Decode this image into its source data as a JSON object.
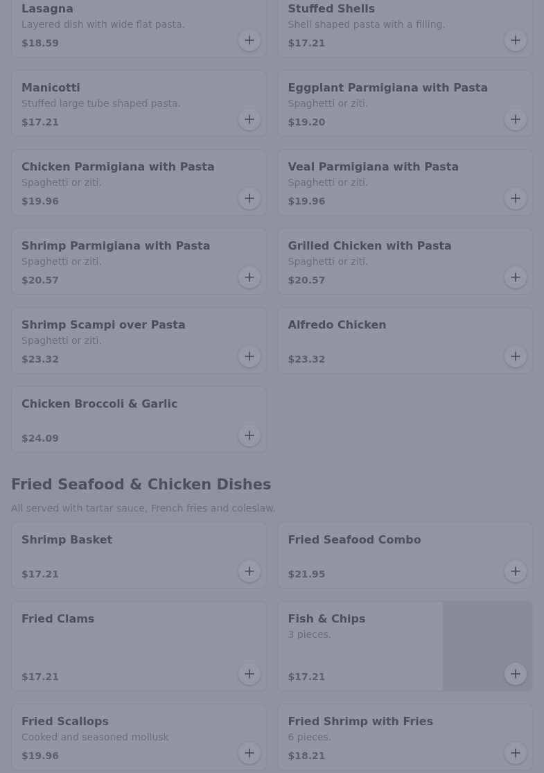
{
  "sections": [
    {
      "items": [
        {
          "name": "Lasagna",
          "description": "Layered dish with wide flat pasta.",
          "price": "$18.59"
        },
        {
          "name": "Stuffed Shells",
          "description": "Shell shaped pasta with a filling.",
          "price": "$17.21"
        },
        {
          "name": "Manicotti",
          "description": "Stuffed large tube shaped pasta.",
          "price": "$17.21"
        },
        {
          "name": "Eggplant Parmigiana with Pasta",
          "description": "Spaghetti or ziti.",
          "price": "$19.20"
        },
        {
          "name": "Chicken Parmigiana with Pasta",
          "description": "Spaghetti or ziti.",
          "price": "$19.96"
        },
        {
          "name": "Veal Parmigiana with Pasta",
          "description": "Spaghetti or ziti.",
          "price": "$19.96"
        },
        {
          "name": "Shrimp Parmigiana with Pasta",
          "description": "Spaghetti or ziti.",
          "price": "$20.57"
        },
        {
          "name": "Grilled Chicken with Pasta",
          "description": "Spaghetti or ziti.",
          "price": "$20.57"
        },
        {
          "name": "Shrimp Scampi over Pasta",
          "description": "Spaghetti or ziti.",
          "price": "$23.32"
        },
        {
          "name": "Alfredo Chicken",
          "price": "$23.32"
        },
        {
          "name": "Chicken Broccoli & Garlic",
          "price": "$24.09"
        }
      ]
    },
    {
      "title": "Fried Seafood & Chicken Dishes",
      "description": "All served with tartar sauce, French fries and coleslaw.",
      "items": [
        {
          "name": "Shrimp Basket",
          "price": "$17.21"
        },
        {
          "name": "Fried Seafood Combo",
          "price": "$21.95"
        },
        {
          "name": "Fried Clams",
          "price": "$17.21"
        },
        {
          "name": "Fish & Chips",
          "description": "3 pieces.",
          "price": "$17.21",
          "kind": "picture"
        },
        {
          "name": "Fried Scallops",
          "description": "Cooked and seasoned mollusk",
          "price": "$19.96"
        },
        {
          "name": "Fried Shrimp with Fries",
          "description": "6 pieces.",
          "price": "$18.21"
        }
      ]
    }
  ]
}
